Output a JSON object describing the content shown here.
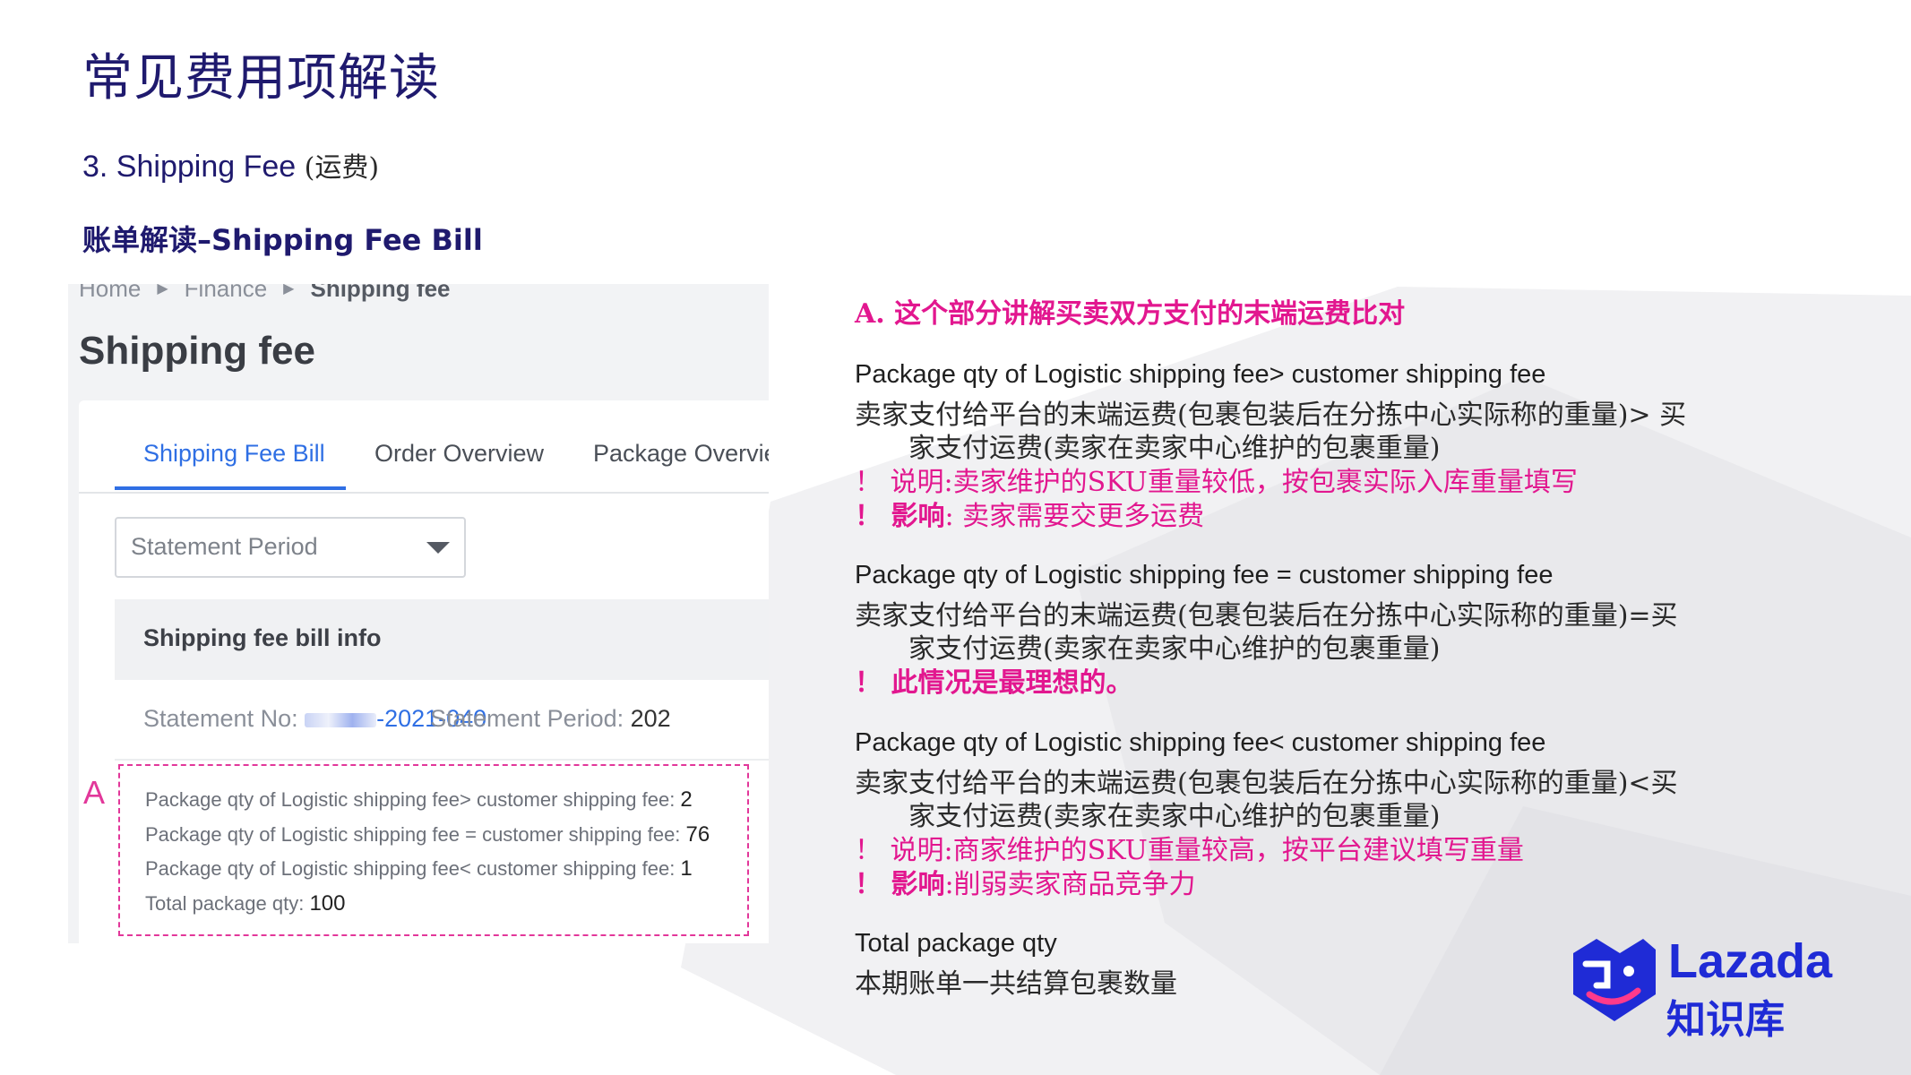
{
  "slide": {
    "title": "常见费用项解读",
    "subtitle_en": "3. Shipping Fee ",
    "subtitle_cn": "(运费)",
    "section_heading": "账单解读–Shipping Fee Bill"
  },
  "screenshot": {
    "breadcrumb": [
      "Home",
      "Finance",
      "Shipping fee"
    ],
    "page_title": "Shipping fee",
    "tabs": [
      {
        "label": "Shipping Fee Bill",
        "active": true
      },
      {
        "label": "Order Overview",
        "active": false
      },
      {
        "label": "Package Overvie",
        "active": false
      }
    ],
    "statement_period_select": {
      "placeholder": "Statement Period"
    },
    "info_header": "Shipping fee bill info",
    "statement_no_label": "Statement No: ",
    "statement_no_value": "-2021-040",
    "statement_period_label": "Statement Period: ",
    "statement_period_value": "202",
    "box_label": "A",
    "box_lines": [
      {
        "label": "Package qty of Logistic shipping fee> customer shipping fee: ",
        "value": "2"
      },
      {
        "label": "Package qty of Logistic shipping fee = customer shipping fee: ",
        "value": "76"
      },
      {
        "label": "Package qty of Logistic shipping fee< customer shipping fee: ",
        "value": "1"
      },
      {
        "label": "Total package qty: ",
        "value": "100"
      }
    ]
  },
  "explanation": {
    "heading": "A.    这个部分讲解买卖双方支付的末端运费比对",
    "blocks": [
      {
        "en": "Package qty of Logistic shipping fee> customer shipping fee",
        "cn1": "卖家支付给平台的末端运费(包裹包装后在分拣中心实际称的重量)> 买",
        "cn2": "家支付运费(卖家在卖家中心维护的包裹重量)",
        "note1_prefix": "！ 说明:",
        "note1_text": "卖家维护的SKU重量较低，按包裹实际入库重量填写",
        "note2_prefix": "！ 影响",
        "note2_text": ": 卖家需要交更多运费"
      },
      {
        "en": "Package qty of Logistic shipping fee = customer shipping fee",
        "cn1": "卖家支付给平台的末端运费(包裹包装后在分拣中心实际称的重量)=买",
        "cn2": "家支付运费(卖家在卖家中心维护的包裹重量)",
        "note1_prefix": "！ 此情况是最理想的。"
      },
      {
        "en": "Package qty of Logistic shipping fee< customer shipping fee",
        "cn1": "卖家支付给平台的末端运费(包裹包装后在分拣中心实际称的重量)<买",
        "cn2": "家支付运费(卖家在卖家中心维护的包裹重量)",
        "note1_prefix": "！ 说明:",
        "note1_text": "商家维护的SKU重量较高，按平台建议填写重量",
        "note2_prefix": "！ 影响",
        "note2_text": ":削弱卖家商品竞争力"
      },
      {
        "en": "Total package qty",
        "cn1": "本期账单一共结算包裹数量"
      }
    ]
  },
  "logo": {
    "brand": "Lazada",
    "sub": "知识库",
    "color": "#1f2bd6"
  },
  "colors": {
    "accent_pink": "#e2178f",
    "title_navy": "#1f1a6e",
    "tab_blue": "#2f6fe4"
  }
}
